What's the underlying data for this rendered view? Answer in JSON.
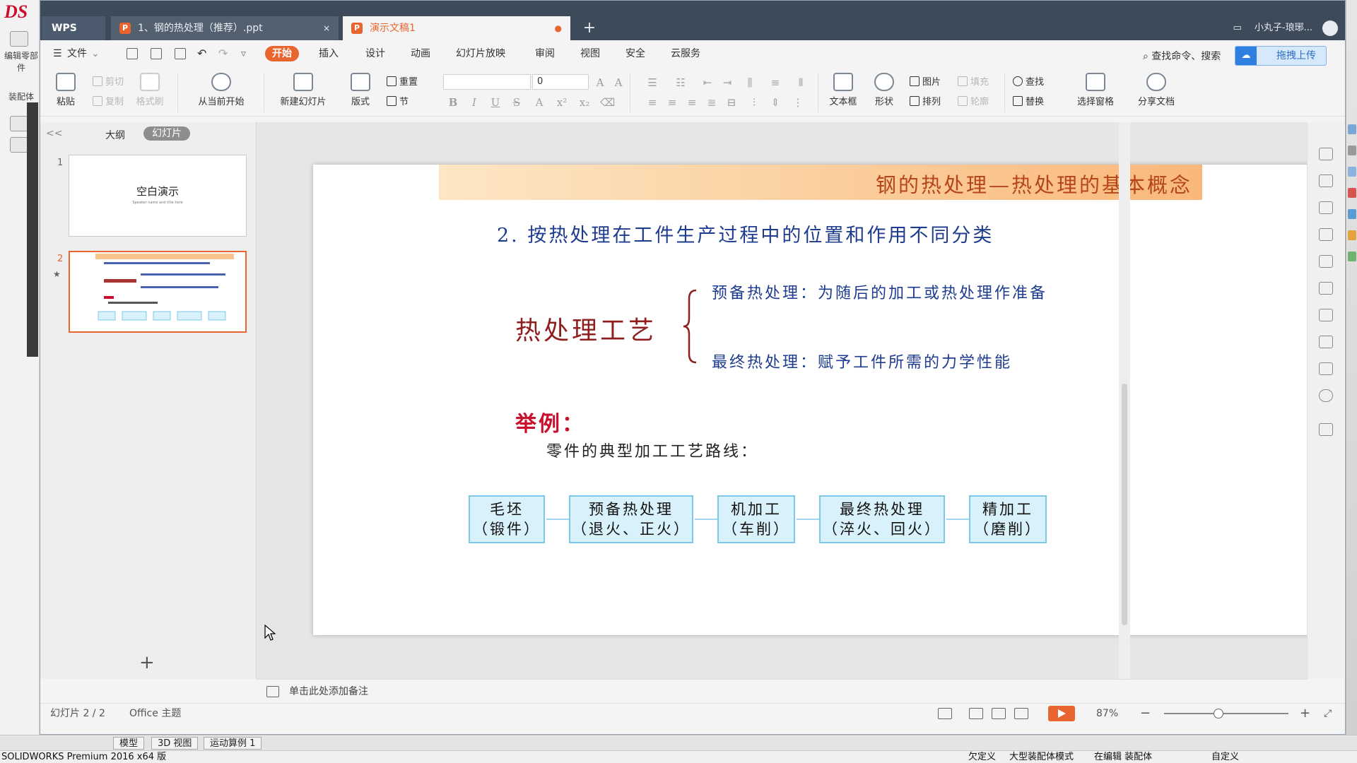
{
  "host_app": {
    "side_labels": [
      "编辑零部件",
      "装配体"
    ],
    "tabs": [
      "模型",
      "3D 视图",
      "运动算例 1"
    ],
    "status_left": "SOLIDWORKS Premium 2016 x64 版",
    "status_items": [
      "欠定义",
      "大型装配体模式",
      "在编辑 装配体",
      "自定义"
    ]
  },
  "wps": {
    "logo": "WPS",
    "tabs": [
      {
        "label": "1、钢的热处理（推荐）.ppt",
        "close": "×"
      },
      {
        "label": "演示文稿1",
        "close": "●"
      }
    ],
    "new_tab": "+",
    "user": "小丸子-琅琊..."
  },
  "menu": {
    "file": "文件",
    "items": [
      "开始",
      "插入",
      "设计",
      "动画",
      "幻灯片放映",
      "审阅",
      "视图",
      "安全",
      "云服务"
    ],
    "search": "查找命令、搜索",
    "upload": "拖拽上传"
  },
  "ribbon": {
    "paste": "粘贴",
    "cut": "剪切",
    "copy": "复制",
    "format_painter": "格式刷",
    "from_current": "从当前开始",
    "new_slide": "新建幻灯片",
    "layout": "版式",
    "reset": "重置",
    "section": "节",
    "font_size": "0",
    "textbox": "文本框",
    "shape": "形状",
    "picture": "图片",
    "fill": "填充",
    "arrange": "排列",
    "outline": "轮廓",
    "find": "查找",
    "replace": "替换",
    "select_pane": "选择窗格",
    "share": "分享文档"
  },
  "panel": {
    "collapse": "<<",
    "outline_tab": "大纲",
    "slides_tab": "幻灯片",
    "thumb1_title": "空白演示",
    "thumb1_sub": "Speaker name and title here",
    "numbers": [
      "1",
      "2"
    ],
    "add": "+"
  },
  "slide": {
    "title": "钢的热处理—热处理的基本概念",
    "heading": "2. 按热处理在工件生产过程中的位置和作用不同分类",
    "process_label": "热处理工艺",
    "branches": [
      "预备热处理：为随后的加工或热处理作准备",
      "最终热处理：赋予工件所需的力学性能"
    ],
    "example_label": "举例：",
    "route_label": "零件的典型加工工艺路线：",
    "steps": [
      {
        "line1": "毛坯",
        "line2": "（锻件）"
      },
      {
        "line1": "预备热处理",
        "line2": "（退火、正火）"
      },
      {
        "line1": "机加工",
        "line2": "（车削）"
      },
      {
        "line1": "最终热处理",
        "line2": "（淬火、回火）"
      },
      {
        "line1": "精加工",
        "line2": "（磨削）"
      }
    ]
  },
  "notes": {
    "placeholder": "单击此处添加备注"
  },
  "status": {
    "slide_count": "幻灯片 2 / 2",
    "theme": "Office 主题",
    "zoom": "87%",
    "zoom_minus": "−",
    "zoom_plus": "+"
  },
  "colors": {
    "accent": "#e8652f",
    "title_text": "#b5461c",
    "heading_text": "#1e3c8f",
    "process_text": "#8f1f1f",
    "example_text": "#c8102e",
    "step_fill": "#d9f1fa",
    "step_border": "#7cc8ea"
  }
}
